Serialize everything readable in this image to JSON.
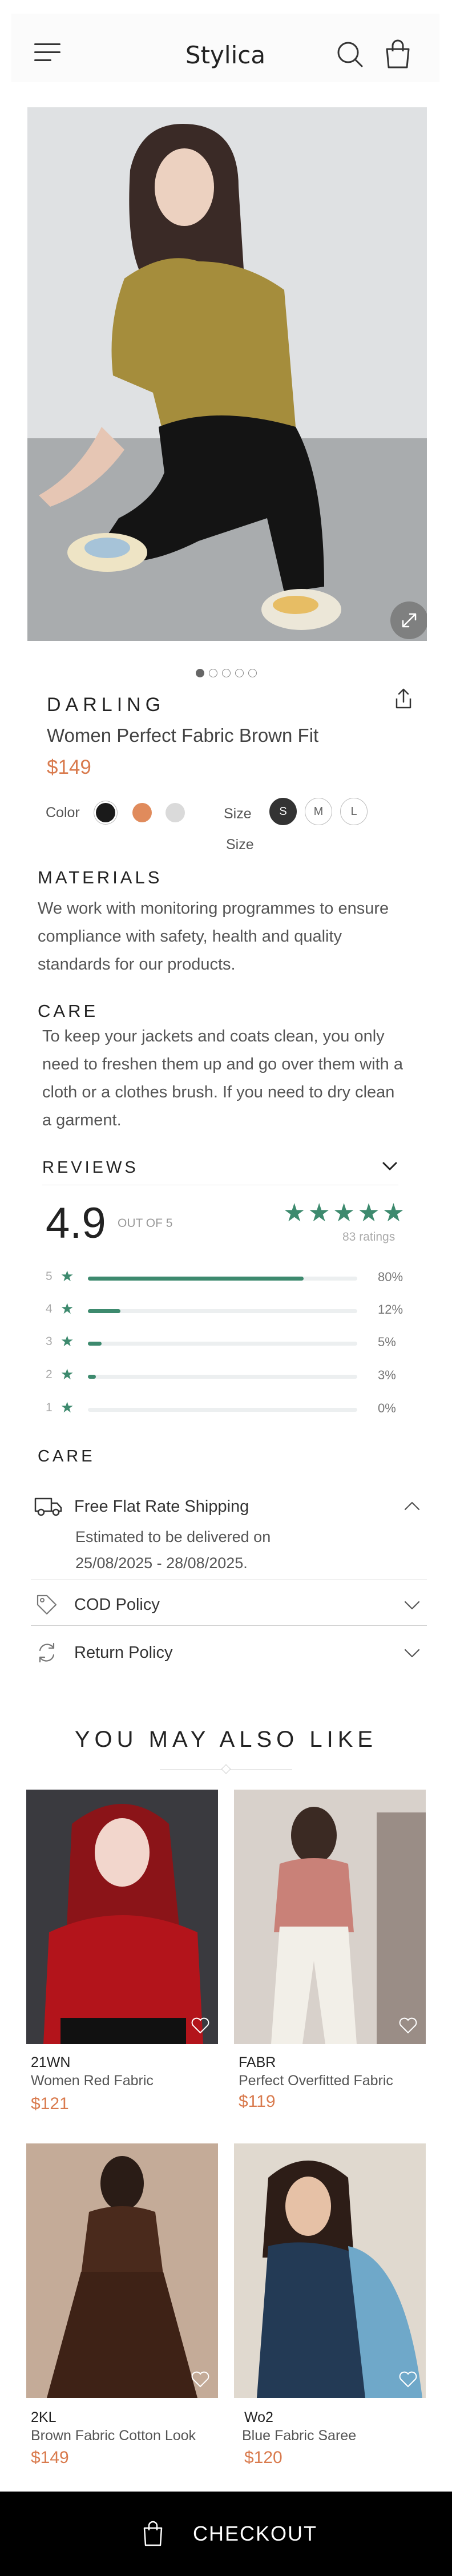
{
  "header": {
    "brand": "Stylica"
  },
  "product": {
    "brand": "DARLING",
    "name": "Women Perfect Fabric Brown Fit",
    "price": "$149",
    "image_count": 5,
    "active_image": 1,
    "color_label": "Color",
    "colors": [
      "#1a1a1a",
      "#e08b5c",
      "#dadada"
    ],
    "selected_color": 0,
    "size_label": "Size",
    "size_label_2": "Size",
    "sizes": [
      "S",
      "M",
      "L"
    ],
    "selected_size": "S"
  },
  "materials": {
    "title": "MATERIALS",
    "lines": [
      "We work with monitoring programmes to ensure",
      "compliance with safety, health and quality",
      "standards for our products."
    ]
  },
  "care": {
    "title": "CARE",
    "lines": [
      "To keep your jackets and coats clean, you only",
      "need to freshen them up and go over them with a",
      "cloth or a clothes brush. If you need to dry clean",
      "a garment."
    ]
  },
  "reviews": {
    "title": "REVIEWS",
    "average": "4.9",
    "out_of": "OUT OF 5",
    "stars": "★★★★★",
    "count": "83 ratings",
    "bars": [
      {
        "stars": "5",
        "percent": 80,
        "label": "80%"
      },
      {
        "stars": "4",
        "percent": 12,
        "label": "12%"
      },
      {
        "stars": "3",
        "percent": 5,
        "label": "5%"
      },
      {
        "stars": "2",
        "percent": 3,
        "label": "3%"
      },
      {
        "stars": "1",
        "percent": 0,
        "label": "0%"
      }
    ]
  },
  "shipping": {
    "title": "CARE",
    "free_shipping": "Free Flat Rate Shipping",
    "estimate_1": "Estimated to be delivered on",
    "estimate_2": "25/08/2025 - 28/08/2025.",
    "cod": "COD Policy",
    "return": "Return Policy"
  },
  "related": {
    "title": "YOU MAY ALSO LIKE",
    "items": [
      {
        "code": "21WN",
        "name": "Women Red Fabric",
        "price": "$121"
      },
      {
        "code": "FABR",
        "name": "Perfect Overfitted Fabric",
        "price": "$119"
      },
      {
        "code": "2KL",
        "name": "Brown Fabric Cotton Look",
        "price": "$149"
      },
      {
        "code": "Wo2",
        "name": "Blue Fabric Saree",
        "price": "$120"
      }
    ]
  },
  "checkout": {
    "label": "CHECKOUT"
  },
  "colors": {
    "accent": "#d97b4e",
    "rating_green": "#3d8a6e",
    "checkout_bg": "#000000"
  }
}
